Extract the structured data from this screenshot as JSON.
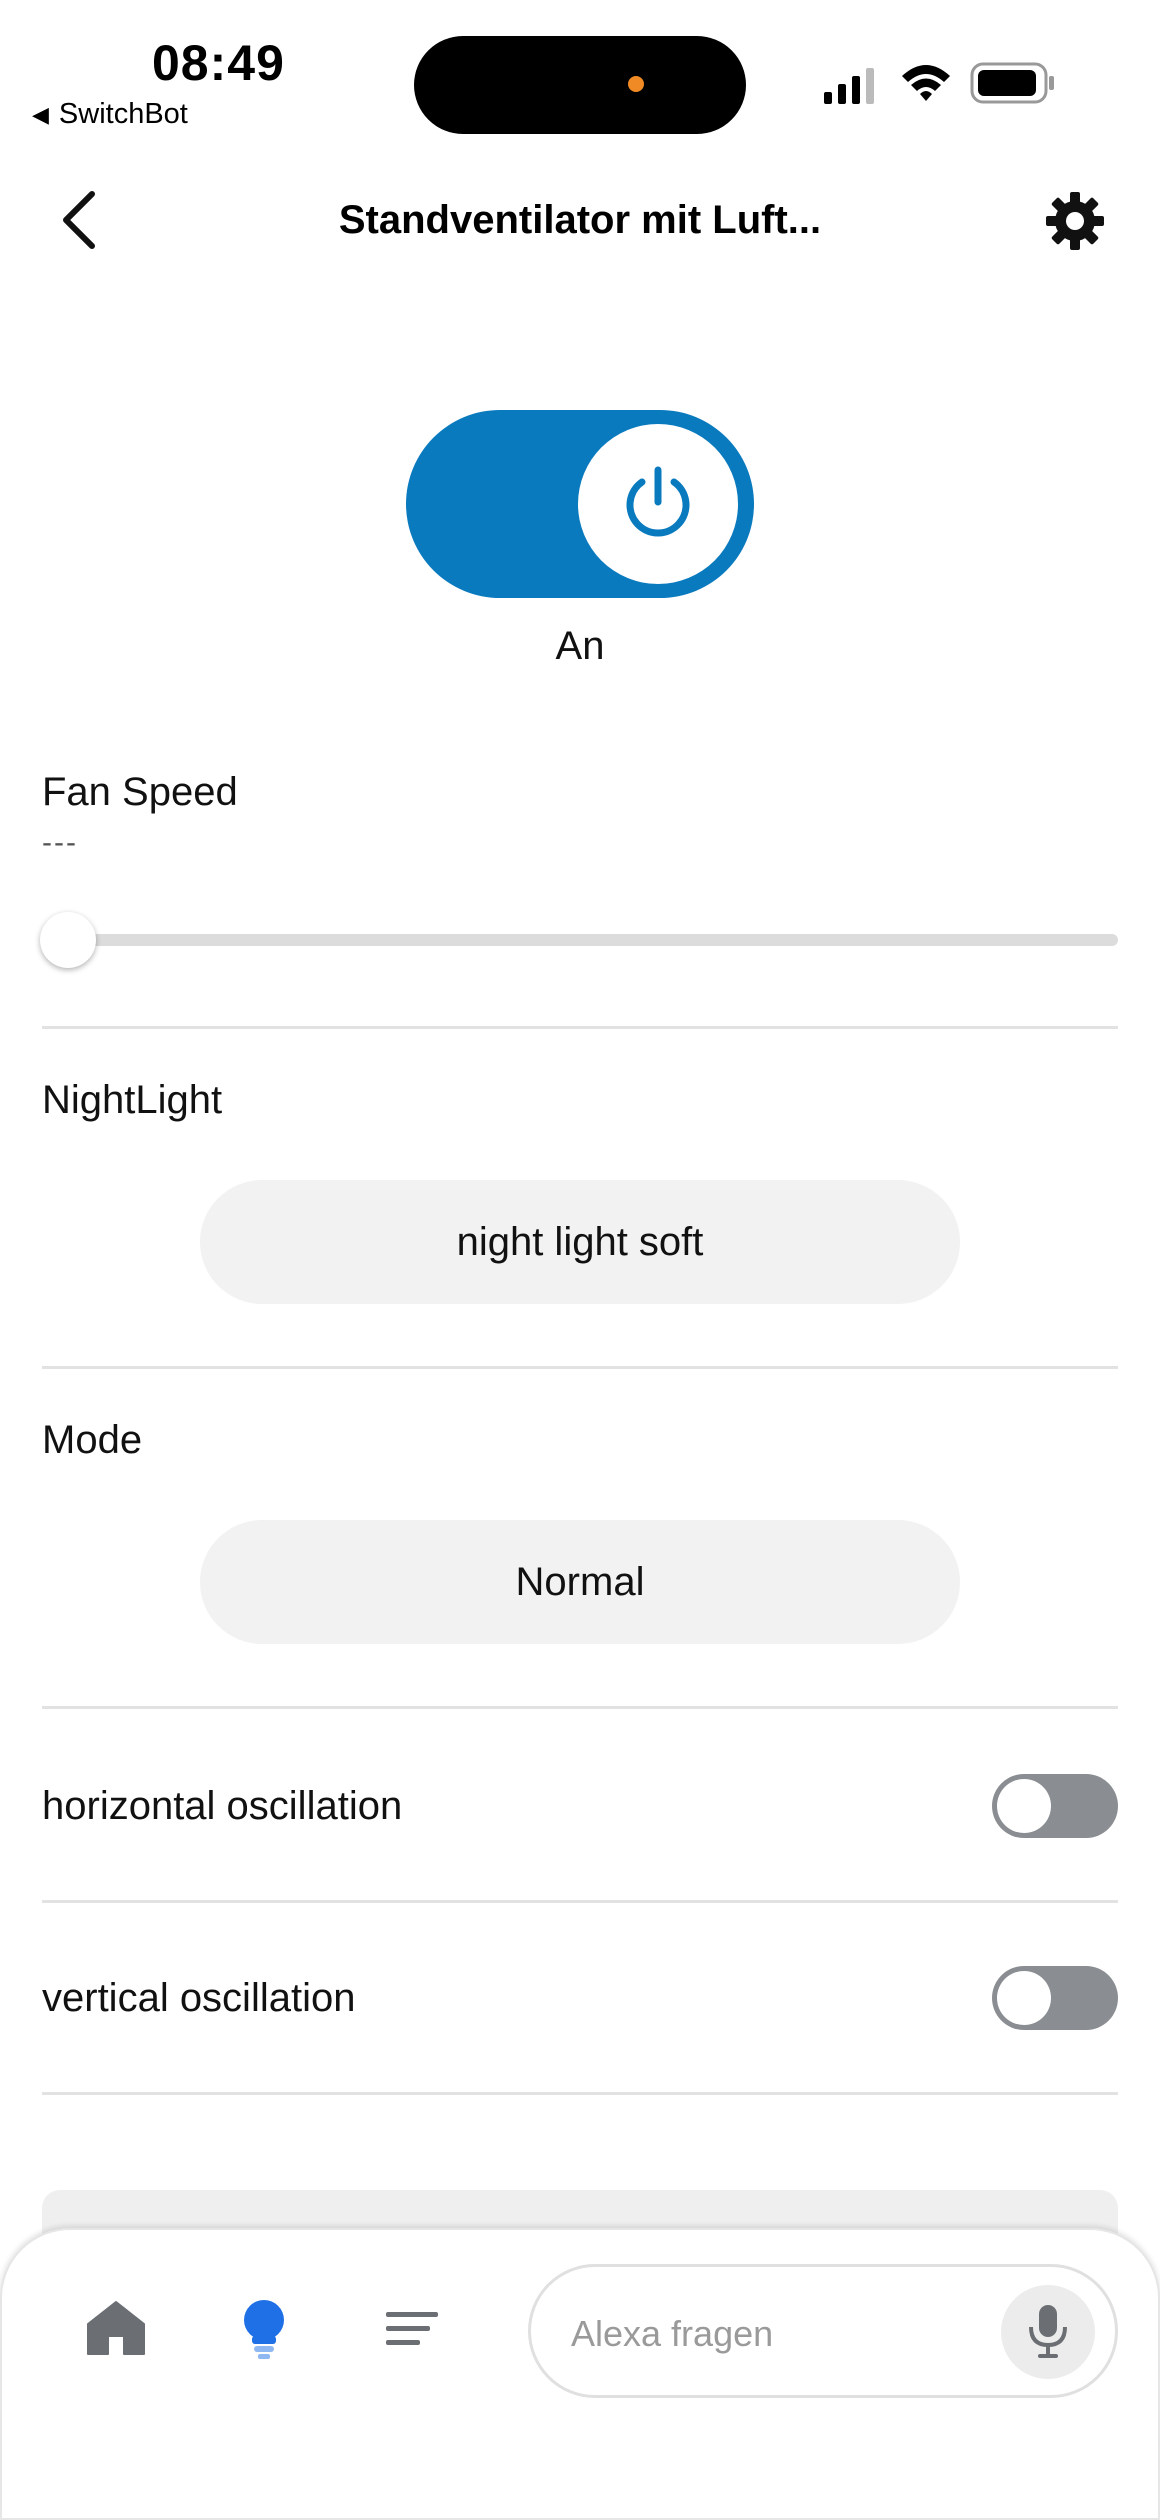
{
  "status_bar": {
    "time": "08:49",
    "back_app": "SwitchBot"
  },
  "header": {
    "title": "Standventilator mit Luft..."
  },
  "power": {
    "state_label": "An",
    "on": true,
    "accent_color": "#0a7abf"
  },
  "fan_speed": {
    "label": "Fan Speed",
    "value": "---",
    "level": 0
  },
  "night_light": {
    "label": "NightLight",
    "selected": "night light soft"
  },
  "mode": {
    "label": "Mode",
    "selected": "Normal"
  },
  "toggles": [
    {
      "label": "horizontal oscillation",
      "on": false
    },
    {
      "label": "vertical oscillation",
      "on": false
    }
  ],
  "bottom_nav": {
    "items": [
      {
        "icon": "home-icon"
      },
      {
        "icon": "lightbulb-icon",
        "active": true,
        "active_color": "#1f6fe6"
      },
      {
        "icon": "menu-icon"
      }
    ],
    "search_placeholder": "Alexa fragen",
    "mic_icon": "microphone-icon"
  }
}
